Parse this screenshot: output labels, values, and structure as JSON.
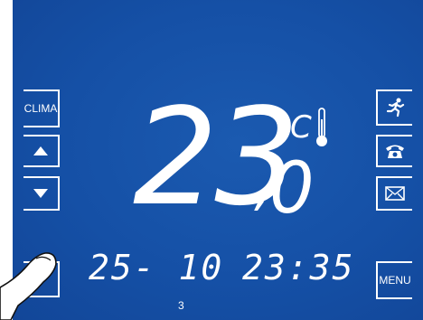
{
  "buttons": {
    "clima": "CLIMA",
    "menu": "MENU"
  },
  "display": {
    "temperature_main": "23",
    "temperature_decimal": "0",
    "temperature_separator": ",",
    "unit": "°C",
    "date": "25- 10",
    "time": "23:35",
    "sub_value": "3"
  },
  "icons": {
    "up": "triangle-up-icon",
    "down": "triangle-down-icon",
    "run": "running-person-icon",
    "phone": "telephone-icon",
    "mail": "envelope-icon",
    "thermometer": "thermometer-icon"
  },
  "colors": {
    "background": "#1550a6",
    "foreground": "#ffffff"
  }
}
